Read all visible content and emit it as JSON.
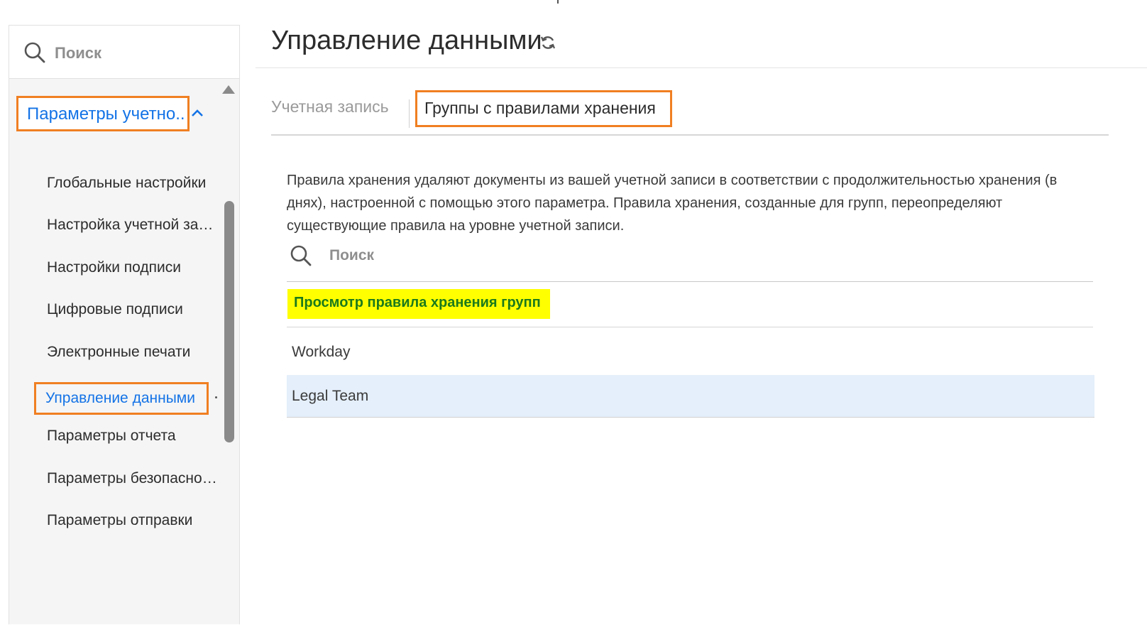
{
  "sidebar": {
    "search_placeholder": "Поиск",
    "group_label": "Параметры учетно...",
    "items": [
      "Глобальные настройки",
      "Настройка учетной зап...",
      "Настройки подписи",
      "Цифровые подписи",
      "Электронные печати",
      "Управление данными",
      "Параметры отчета",
      "Параметры безопаснос...",
      "Параметры отправки"
    ],
    "active_index": 5
  },
  "main": {
    "title": "Управление данными",
    "tabs": [
      {
        "label": "Учетная запись",
        "active": false
      },
      {
        "label": "Группы с правилами хранения",
        "active": true
      }
    ],
    "description": "Правила хранения удаляют документы из вашей учетной записи в соответствии с продолжительностью хранения (в днях), настроенной с помощью этого параметра. Правила хранения, созданные для групп, переопределяют существующие правила на уровне учетной записи.",
    "search_placeholder": "Поиск",
    "list_heading": "Просмотр правила хранения групп",
    "rows": [
      {
        "name": "Workday",
        "selected": false
      },
      {
        "name": "Legal Team",
        "selected": true
      }
    ]
  },
  "colors": {
    "accent_blue": "#1473e6",
    "annotation_orange": "#f07f22",
    "highlight_yellow": "#ffff00",
    "heading_green": "#1b7a1b",
    "selected_row": "#e4effb"
  },
  "icons": [
    "search-icon",
    "chevron-up-icon",
    "refresh-icon",
    "scroll-up-arrow-icon"
  ]
}
